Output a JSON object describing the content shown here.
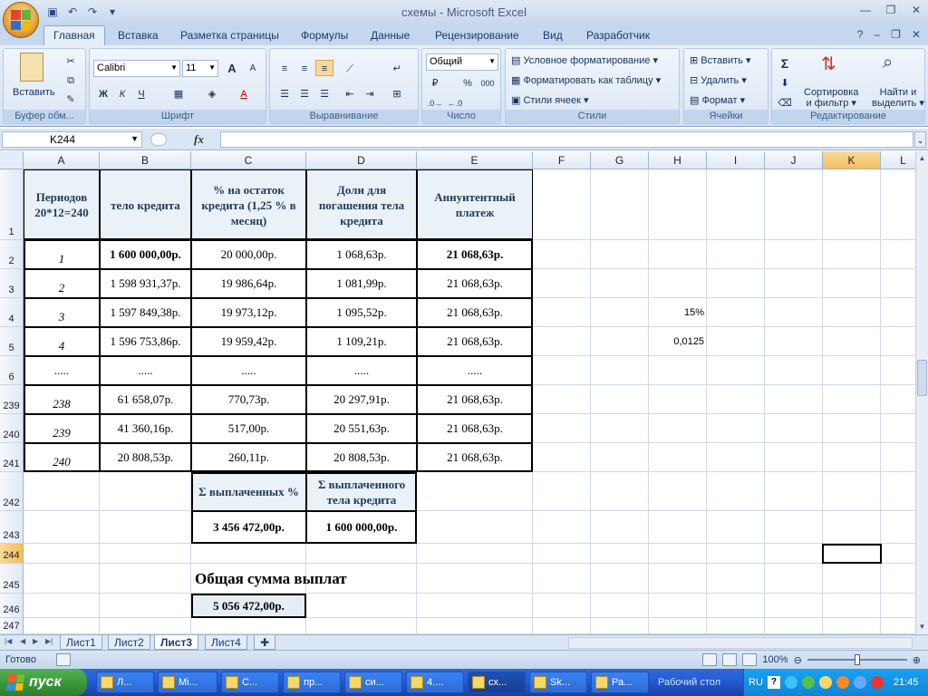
{
  "window": {
    "title": "схемы - Microsoft Excel"
  },
  "ribbon": {
    "tabs": [
      "Главная",
      "Вставка",
      "Разметка страницы",
      "Формулы",
      "Данные",
      "Рецензирование",
      "Вид",
      "Разработчик"
    ],
    "clipboard": {
      "paste": "Вставить",
      "title": "Буфер обм..."
    },
    "font": {
      "name": "Calibri",
      "size": "11",
      "bold": "Ж",
      "italic": "К",
      "underline": "Ч",
      "grow": "A",
      "shrink": "A",
      "color": "A",
      "title": "Шрифт"
    },
    "alignment": {
      "title": "Выравнивание"
    },
    "number": {
      "format": "Общий",
      "percent": "%",
      "thousands": "000",
      "title": "Число"
    },
    "styles": {
      "conditional": "Условное форматирование",
      "table": "Форматировать как таблицу",
      "cell_styles": "Стили ячеек",
      "title": "Стили"
    },
    "cells": {
      "insert": "Вставить",
      "delete": "Удалить",
      "format": "Формат",
      "title": "Ячейки"
    },
    "editing": {
      "sum": "Σ",
      "sort_l1": "Сортировка",
      "sort_l2": "и фильтр",
      "find_l1": "Найти и",
      "find_l2": "выделить",
      "title": "Редактирование"
    }
  },
  "formula_bar": {
    "name_box": "K244",
    "fx": "fx",
    "formula": ""
  },
  "columns": [
    "A",
    "B",
    "C",
    "D",
    "E",
    "F",
    "G",
    "H",
    "I",
    "J",
    "K",
    "L"
  ],
  "rows": [
    "1",
    "2",
    "3",
    "4",
    "5",
    "6",
    "239",
    "240",
    "241",
    "242",
    "243",
    "244",
    "245",
    "246",
    "247"
  ],
  "table": {
    "headers": [
      "Периодов 20*12=240",
      "тело кредита",
      "% на остаток кредита (1,25 % в месяц)",
      "Доли для погашения тела кредита",
      "Аннуитентный платеж"
    ],
    "rows": [
      [
        "1",
        "1 600 000,00р.",
        "20 000,00р.",
        "1 068,63р.",
        "21 068,63р."
      ],
      [
        "2",
        "1 598 931,37р.",
        "19 986,64р.",
        "1 081,99р.",
        "21 068,63р."
      ],
      [
        "3",
        "1 597 849,38р.",
        "19 973,12р.",
        "1 095,52р.",
        "21 068,63р."
      ],
      [
        "4",
        "1 596 753,86р.",
        "19 959,42р.",
        "1 109,21р.",
        "21 068,63р."
      ],
      [
        ".....",
        ".....",
        ".....",
        ".....",
        "....."
      ],
      [
        "238",
        "61 658,07р.",
        "770,73р.",
        "20 297,91р.",
        "21 068,63р."
      ],
      [
        "239",
        "41 360,16р.",
        "517,00р.",
        "20 551,63р.",
        "21 068,63р."
      ],
      [
        "240",
        "20 808,53р.",
        "260,11р.",
        "20 808,53р.",
        "21 068,63р."
      ]
    ]
  },
  "side_values": {
    "h4": "15%",
    "h5": "0,0125"
  },
  "summary": {
    "paid_percent_label": "Σ выплаченных %",
    "paid_body_label": "Σ выплаченного тела кредита",
    "paid_percent_value": "3 456 472,00р.",
    "paid_body_value": "1 600 000,00р.",
    "total_label": "Общая сумма выплат",
    "total_value": "5 056 472,00р."
  },
  "sheets": [
    "Лист1",
    "Лист2",
    "Лист3",
    "Лист4"
  ],
  "active_sheet": "Лист3",
  "status": {
    "ready": "Готово",
    "zoom": "100%"
  },
  "taskbar": {
    "start": "пуск",
    "buttons": [
      "Л...",
      "Mi...",
      "С...",
      "пр...",
      "си...",
      "4....",
      "сх...",
      "Sk...",
      "Ра..."
    ],
    "desktop": "Рабочий стол",
    "lang": "RU",
    "clock": "21:45"
  }
}
